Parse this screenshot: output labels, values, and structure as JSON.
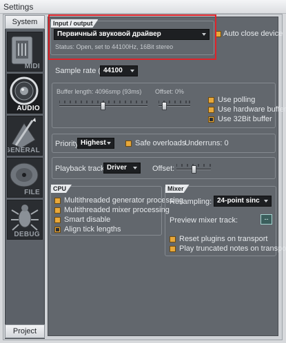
{
  "window": {
    "title": "Settings"
  },
  "sidebar": {
    "top_tab": "System",
    "bottom_tab": "Project",
    "items": [
      {
        "label": "MIDI",
        "icon": "midi-connector-icon"
      },
      {
        "label": "AUDIO",
        "icon": "speaker-icon"
      },
      {
        "label": "GENERAL",
        "icon": "pen-paper-icon"
      },
      {
        "label": "FILE",
        "icon": "disc-icon"
      },
      {
        "label": "DEBUG",
        "icon": "bug-icon"
      }
    ]
  },
  "io": {
    "title": "Input / output",
    "device": "Первичный звуковой драйвер",
    "status": "Status:  Open, set to 44100Hz, 16Bit stereo",
    "auto_close": "Auto close device"
  },
  "sample_rate": {
    "label": "Sample rate (Hz)",
    "value": "44100"
  },
  "buffer": {
    "length_label": "Buffer length: 4096smp (93ms)",
    "offset_label": "Offset: 0%",
    "use_polling": "Use polling",
    "use_hardware_buffer": "Use hardware buffer",
    "use_32bit_buffer": "Use 32Bit buffer"
  },
  "priority": {
    "label": "Priority:",
    "value": "Highest",
    "safe_overloads": "Safe overloads",
    "underruns": "Underruns: 0"
  },
  "playback": {
    "label": "Playback tracking:",
    "value": "Driver",
    "offset_label": "Offset:"
  },
  "cpu": {
    "title": "CPU",
    "options": [
      "Multithreaded generator processing",
      "Multithreaded mixer processing",
      "Smart disable",
      "Align tick lengths"
    ]
  },
  "mixer": {
    "title": "Mixer",
    "resampling_label": "Resampling:",
    "resampling_value": "24-point sinc",
    "preview_label": "Preview mixer track:",
    "preview_value": "--",
    "reset_plugins": "Reset plugins on transport",
    "play_truncated": "Play truncated notes on transport"
  },
  "colors": {
    "accent_checkbox": "#e8a83a",
    "highlight": "#e0232a",
    "panel": "#62676d"
  }
}
